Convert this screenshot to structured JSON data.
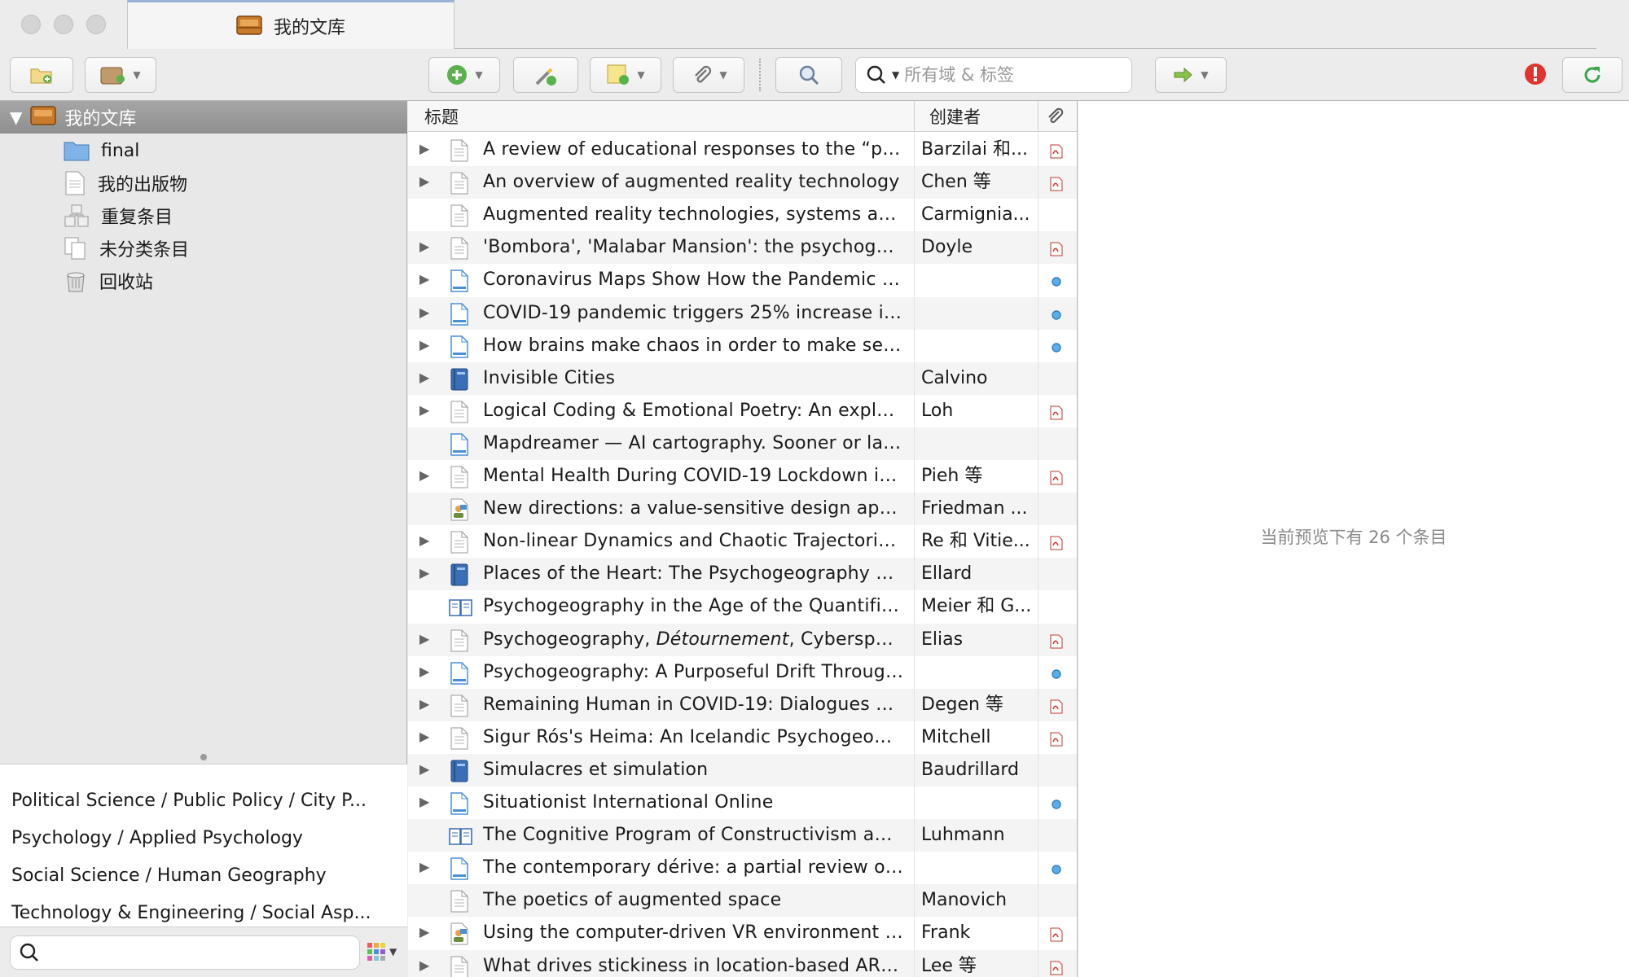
{
  "tab": {
    "title": "我的文库"
  },
  "toolbar": {
    "search_placeholder": "所有域 & 标签"
  },
  "library": {
    "header": "我的文库",
    "collections": [
      {
        "label": "final",
        "icon": "folder-icon"
      },
      {
        "label": "我的出版物",
        "icon": "document-icon"
      },
      {
        "label": "重复条目",
        "icon": "duplicate-items-icon"
      },
      {
        "label": "未分类条目",
        "icon": "unfiled-items-icon"
      },
      {
        "label": "回收站",
        "icon": "trash-icon"
      }
    ]
  },
  "tags": [
    "Political Science / Public Policy / City P...",
    "Psychology / Applied Psychology",
    "Social Science / Human Geography",
    "Technology & Engineering / Social Asp..."
  ],
  "columns": {
    "title": "标题",
    "creator": "创建者"
  },
  "items": [
    {
      "title": "A review of educational responses to the “post...",
      "creator": "Barzilai 和...",
      "type": "doc",
      "expand": true,
      "att": "pdf"
    },
    {
      "title": "An overview of augmented reality technology",
      "creator": "Chen 等",
      "type": "doc",
      "expand": true,
      "att": "pdf"
    },
    {
      "title": "Augmented reality technologies, systems and ...",
      "creator": "Carmignia...",
      "type": "doc",
      "expand": false,
      "att": ""
    },
    {
      "title": "'Bombora', 'Malabar Mansion': the psychogeog...",
      "creator": "Doyle",
      "type": "doc",
      "expand": true,
      "att": "pdf"
    },
    {
      "title": "Coronavirus Maps Show How the Pandemic Re...",
      "creator": "",
      "type": "web",
      "expand": true,
      "att": "dot"
    },
    {
      "title": "COVID-19 pandemic triggers 25% increase in ...",
      "creator": "",
      "type": "web",
      "expand": true,
      "att": "dot"
    },
    {
      "title": "How brains make chaos in order to make sens...",
      "creator": "",
      "type": "web",
      "expand": true,
      "att": "dot"
    },
    {
      "title": "Invisible Cities",
      "creator": "Calvino",
      "type": "book",
      "expand": true,
      "att": ""
    },
    {
      "title": "Logical Coding & Emotional Poetry: An explora...",
      "creator": "Loh",
      "type": "doc",
      "expand": true,
      "att": "pdf"
    },
    {
      "title": "Mapdreamer — AI cartography. Sooner or late...",
      "creator": "",
      "type": "web",
      "expand": false,
      "att": ""
    },
    {
      "title": "Mental Health During COVID-19 Lockdown in ...",
      "creator": "Pieh 等",
      "type": "doc",
      "expand": true,
      "att": "pdf"
    },
    {
      "title": "New directions: a value-sensitive design appr...",
      "creator": "Friedman ...",
      "type": "conf",
      "expand": false,
      "att": ""
    },
    {
      "title": "Non-linear Dynamics and Chaotic Trajectories...",
      "creator": "Re 和 Vitie...",
      "type": "doc",
      "expand": true,
      "att": "pdf"
    },
    {
      "title": "Places of the Heart: The Psychogeography of E...",
      "creator": "Ellard",
      "type": "book",
      "expand": true,
      "att": ""
    },
    {
      "title": "Psychogeography in the Age of the Quantified ...",
      "creator": "Meier 和 G...",
      "type": "section",
      "expand": false,
      "att": ""
    },
    {
      "title": "Psychogeography, Détournement, Cyberspace",
      "creator": "Elias",
      "type": "doc",
      "expand": true,
      "att": "pdf"
    },
    {
      "title": "Psychogeography: A Purposeful Drift Through ...",
      "creator": "",
      "type": "web",
      "expand": true,
      "att": "dot"
    },
    {
      "title": "Remaining Human in COVID-19: Dialogues on...",
      "creator": "Degen 等",
      "type": "doc",
      "expand": true,
      "att": "pdf"
    },
    {
      "title": "Sigur Rós's Heima: An Icelandic Psychogeogra...",
      "creator": "Mitchell",
      "type": "doc",
      "expand": true,
      "att": "pdf"
    },
    {
      "title": "Simulacres et simulation",
      "creator": "Baudrillard",
      "type": "book",
      "expand": true,
      "att": ""
    },
    {
      "title": "Situationist International Online",
      "creator": "",
      "type": "web",
      "expand": true,
      "att": "dot"
    },
    {
      "title": "The Cognitive Program of Constructivism and ...",
      "creator": "Luhmann",
      "type": "section",
      "expand": false,
      "att": ""
    },
    {
      "title": "The contemporary dérive: a partial review of is...",
      "creator": "",
      "type": "web",
      "expand": true,
      "att": "dot"
    },
    {
      "title": "The poetics of augmented space",
      "creator": "Manovich",
      "type": "doc",
      "expand": false,
      "att": ""
    },
    {
      "title": "Using the computer-driven VR environment to...",
      "creator": "Frank",
      "type": "conf",
      "expand": true,
      "att": "pdf"
    },
    {
      "title": "What drives stickiness in location-based AR g...",
      "creator": "Lee 等",
      "type": "doc",
      "expand": true,
      "att": "pdf"
    }
  ],
  "preview": {
    "message": "当前预览下有 26 个条目"
  },
  "colors": {
    "accent_blue": "#4a90d9",
    "pdf_red": "#d9302c",
    "library_orange": "#c97a2a",
    "error_red": "#e0332f",
    "sync_green": "#3aa64a"
  }
}
